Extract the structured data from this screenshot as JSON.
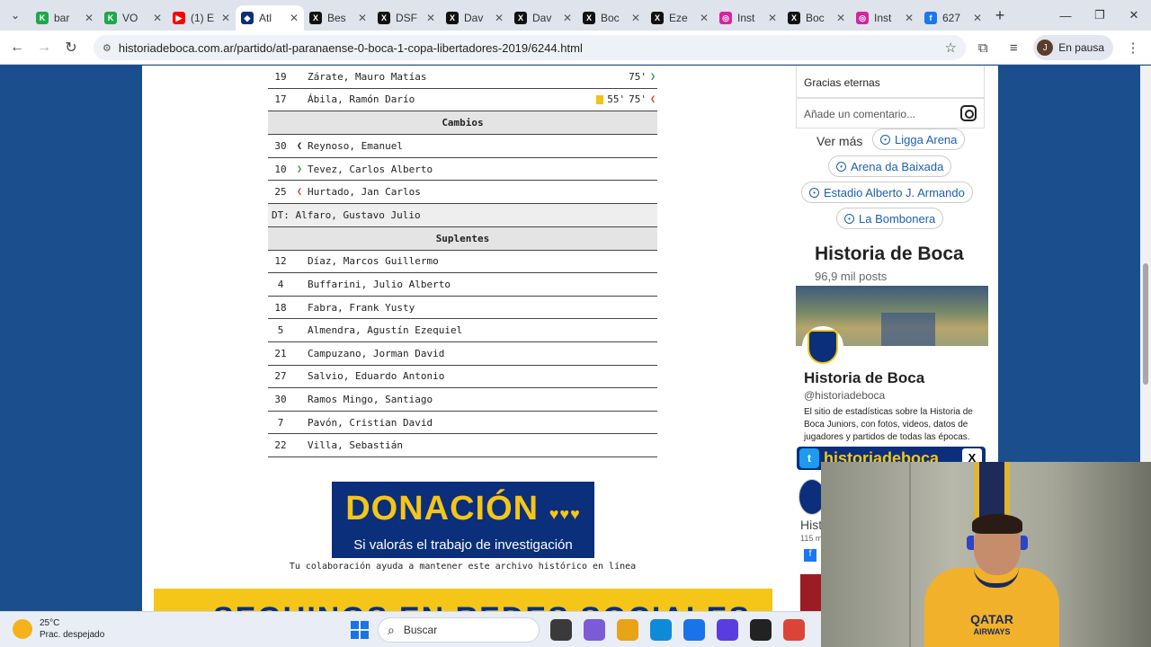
{
  "browser": {
    "tabs": [
      {
        "label": "bar",
        "color": "#1fa84a",
        "glyph": "K"
      },
      {
        "label": "VO",
        "color": "#1fa84a",
        "glyph": "K"
      },
      {
        "label": "(1) E",
        "color": "#ff0000",
        "glyph": "▶"
      },
      {
        "label": "Atl",
        "color": "#0b2f7a",
        "glyph": "◆"
      },
      {
        "label": "Bes",
        "color": "#111111",
        "glyph": "X"
      },
      {
        "label": "DSF",
        "color": "#111111",
        "glyph": "X"
      },
      {
        "label": "Dav",
        "color": "#111111",
        "glyph": "X"
      },
      {
        "label": "Dav",
        "color": "#111111",
        "glyph": "X"
      },
      {
        "label": "Boc",
        "color": "#111111",
        "glyph": "X"
      },
      {
        "label": "Eze",
        "color": "#111111",
        "glyph": "X"
      },
      {
        "label": "Inst",
        "color": "#d6249f",
        "glyph": "◎"
      },
      {
        "label": "Boc",
        "color": "#111111",
        "glyph": "X"
      },
      {
        "label": "Inst",
        "color": "#d6249f",
        "glyph": "◎"
      },
      {
        "label": "627",
        "color": "#1877f2",
        "glyph": "f"
      }
    ],
    "active_tab_index": 3,
    "url": "historiadeboca.com.ar/partido/atl-paranaense-0-boca-1-copa-libertadores-2019/6244.html",
    "profile_initial": "J",
    "profile_status": "En pausa"
  },
  "lineup": {
    "top_rows": [
      {
        "num": "19",
        "name": "Zárate, Mauro Matías",
        "yellow": "",
        "sub_min": "75'",
        "sub_arrow": "green"
      },
      {
        "num": "17",
        "name": "Ábila, Ramón Darío",
        "yellow": "55'",
        "sub_min": "75'",
        "sub_arrow": "red"
      }
    ],
    "cambios_title": "Cambios",
    "cambios": [
      {
        "num": "30",
        "arrow": "black",
        "name": "Reynoso, Emanuel"
      },
      {
        "num": "10",
        "arrow": "green",
        "name": "Tevez, Carlos Alberto"
      },
      {
        "num": "25",
        "arrow": "red",
        "name": "Hurtado, Jan Carlos"
      }
    ],
    "dt": "DT: Alfaro, Gustavo Julio",
    "suplentes_title": "Suplentes",
    "suplentes": [
      {
        "num": "12",
        "name": "Díaz, Marcos Guillermo"
      },
      {
        "num": "4",
        "name": "Buffarini, Julio Alberto"
      },
      {
        "num": "18",
        "name": "Fabra, Frank Yusty"
      },
      {
        "num": "5",
        "name": "Almendra, Agustín Ezequiel"
      },
      {
        "num": "21",
        "name": "Campuzano, Jorman David"
      },
      {
        "num": "27",
        "name": "Salvio, Eduardo Antonio"
      },
      {
        "num": "30",
        "name": "Ramos Mingo, Santiago"
      },
      {
        "num": "7",
        "name": "Pavón, Cristian David"
      },
      {
        "num": "22",
        "name": "Villa, Sebastián"
      }
    ]
  },
  "donation": {
    "title": "DONACIÓN",
    "subtitle": "Si valorás el trabajo de investigación",
    "caption": "Tu colaboración ayuda a mantener este archivo histórico en línea"
  },
  "follow_banner": "SEGUINOS EN REDES SOCIALES",
  "sidebar": {
    "ig_caption": "Gracias eternas",
    "ig_comment_placeholder": "Añade un comentario...",
    "ver_mas": "Ver más",
    "places": [
      "Ligga Arena",
      "Arena da Baixada",
      "Estadio Alberto J. Armando",
      "La Bombonera"
    ],
    "profile_title": "Historia de Boca",
    "profile_posts": "96,9 mil posts",
    "profile_name": "Historia de Boca",
    "profile_handle": "@historiadeboca",
    "profile_bio": "El sitio de estadísticas sobre la Historia de Boca Juniors, con fotos, videos, datos de jugadores y partidos de todas las épocas.",
    "twitter_banner": "historiadeboca",
    "mini_name": "Hist",
    "mini_count": "115 m"
  },
  "webcam": {
    "sponsor": "QATAR",
    "sponsor_sub": "AIRWAYS"
  },
  "taskbar": {
    "temp": "25°C",
    "weather": "Prac. despejado",
    "search": "Buscar",
    "app_colors": [
      "#3a3a3a",
      "#7b5cd6",
      "#e8a317",
      "#0f8ad8",
      "#1a73e8",
      "#5a3de0",
      "#222222",
      "#db4437"
    ]
  }
}
